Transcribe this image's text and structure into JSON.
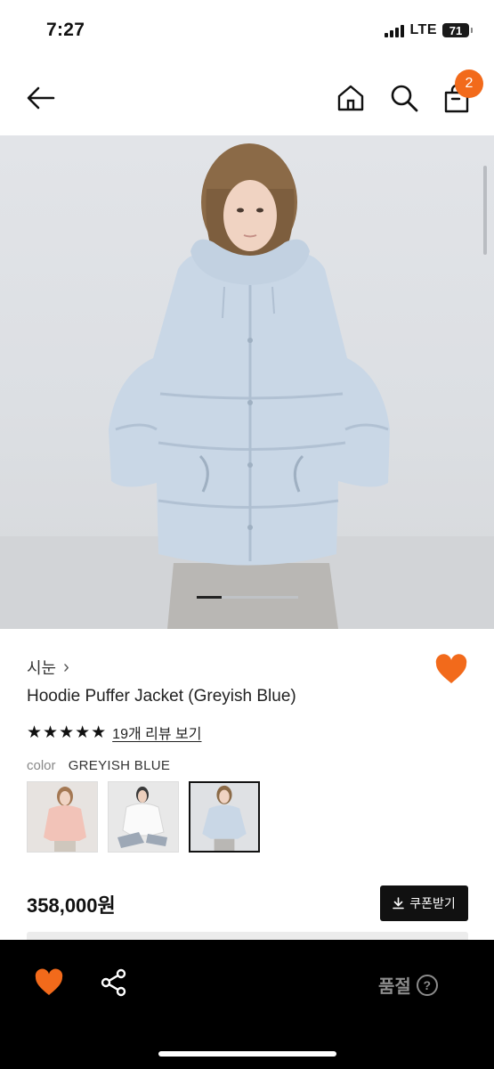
{
  "status_bar": {
    "time": "7:27",
    "network": "LTE",
    "battery": "71"
  },
  "nav": {
    "cart_count": "2",
    "icons": [
      "back-arrow-icon",
      "home-icon",
      "search-icon",
      "shopping-bag-icon"
    ]
  },
  "product": {
    "brand": "시눈",
    "brand_chevron": "›",
    "name": "Hoodie Puffer Jacket (Greyish Blue)",
    "stars": "★★★★★",
    "review_link": "19개 리뷰 보기",
    "color_label": "color",
    "color_value": "GREYISH BLUE",
    "swatches": [
      "pink",
      "white",
      "greyish-blue"
    ],
    "selected_swatch": 2,
    "price": "358,000원",
    "coupon_label": "쿠폰받기",
    "image_pages_total": 4,
    "image_page_current": 1
  },
  "bottom_bar": {
    "soldout_label": "품절",
    "help_glyph": "?"
  },
  "colors": {
    "accent": "#f26a1b",
    "dark": "#111111",
    "jacket": "#c9d7e6"
  }
}
